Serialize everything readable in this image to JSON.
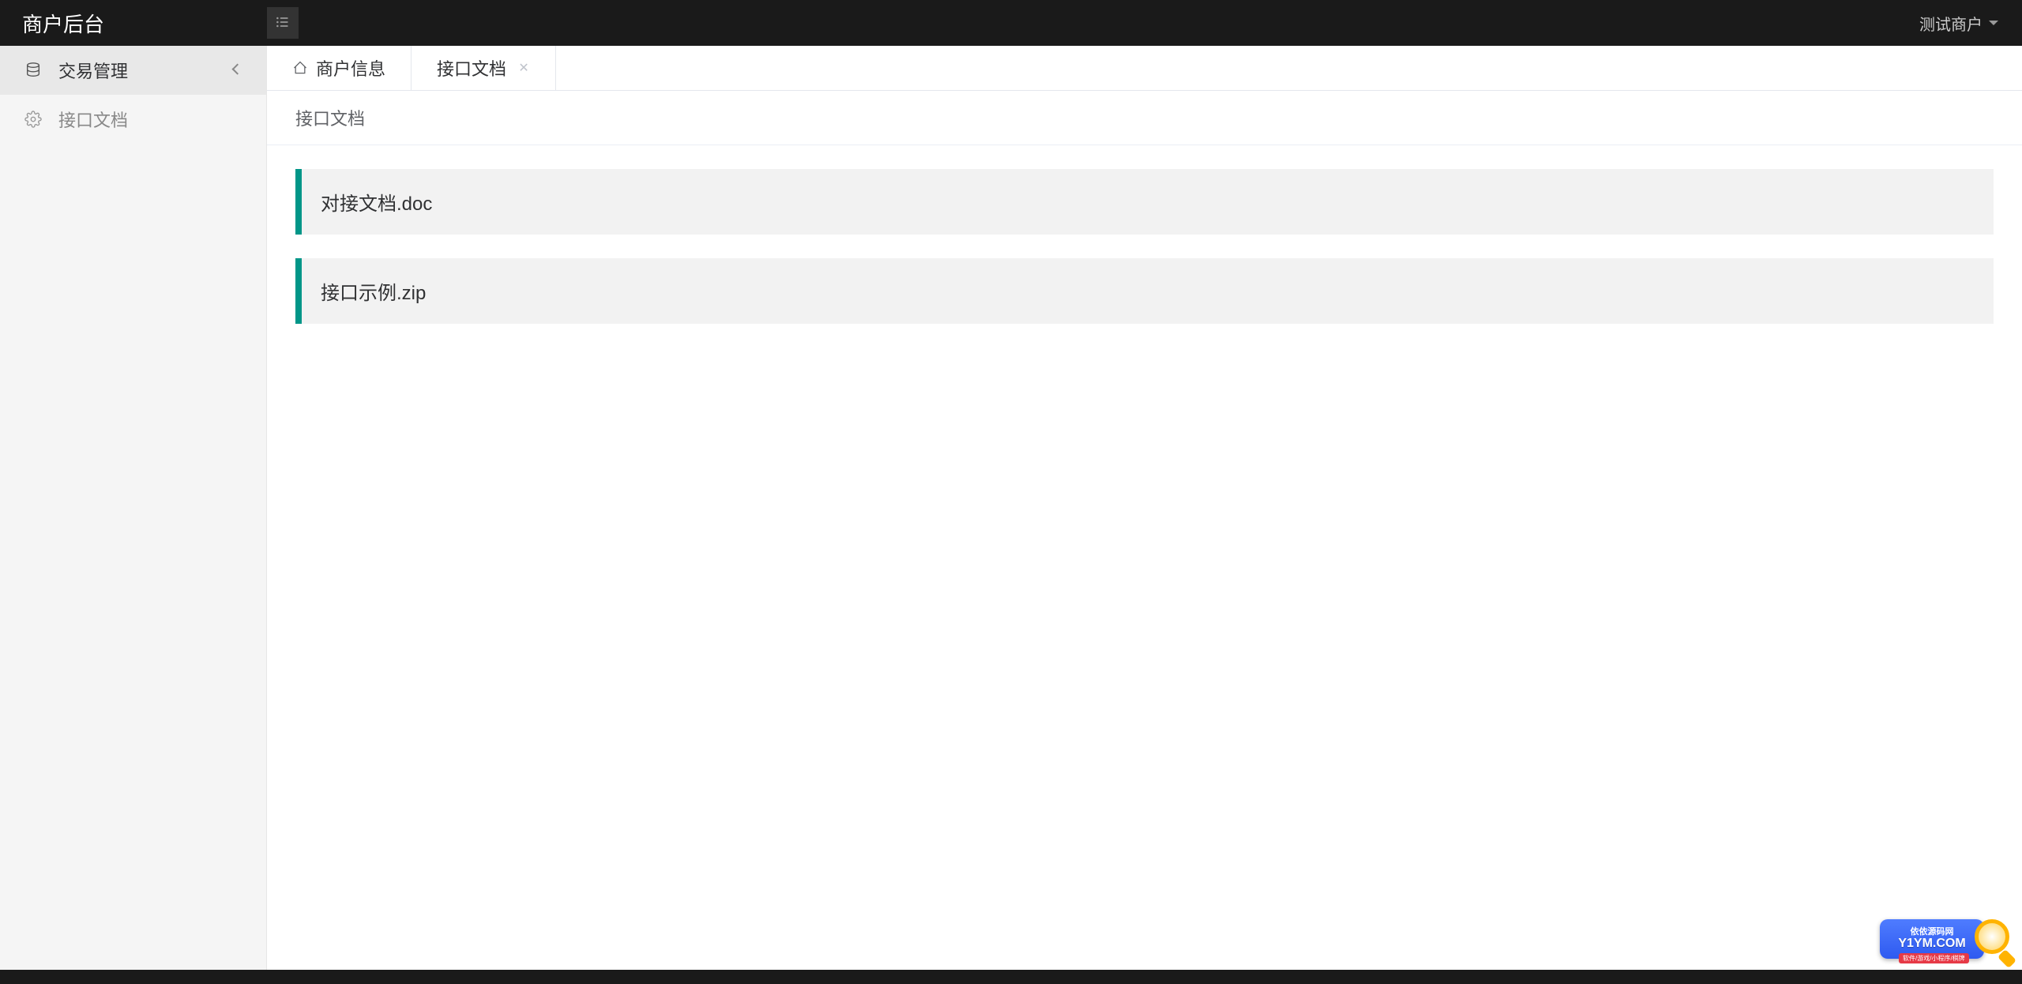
{
  "header": {
    "logo_text": "商户后台",
    "user_label": "测试商户"
  },
  "sidebar": {
    "items": [
      {
        "label": "交易管理",
        "icon": "database",
        "active": true,
        "expandable": true
      },
      {
        "label": "接口文档",
        "icon": "gear",
        "active": false,
        "expandable": false
      }
    ]
  },
  "tabs": [
    {
      "label": "商户信息",
      "icon": "home",
      "closable": false,
      "active": false
    },
    {
      "label": "接口文档",
      "icon": "",
      "closable": true,
      "active": true
    }
  ],
  "page": {
    "title": "接口文档",
    "files": [
      {
        "name": "对接文档.doc"
      },
      {
        "name": "接口示例.zip"
      }
    ]
  },
  "watermark": {
    "top": "依依源码网",
    "domain": "Y1YM.COM",
    "sub": "软件/游戏/小程序/棋牌"
  }
}
